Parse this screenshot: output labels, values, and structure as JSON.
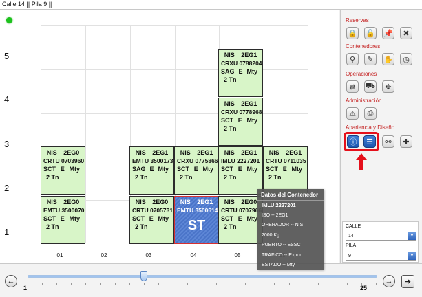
{
  "window": {
    "title": "Calle 14 || Pila 9 ||"
  },
  "grid": {
    "y_labels": [
      "5",
      "4",
      "3",
      "2",
      "1"
    ],
    "x_labels": [
      "01",
      "02",
      "03",
      "04",
      "05",
      "06"
    ]
  },
  "containers": {
    "c1": {
      "line1": [
        "NIS",
        "2EG0"
      ],
      "code": "CRTU 0703960",
      "line3": [
        "SCT",
        "E",
        "Mty"
      ],
      "weight": "2 Tn"
    },
    "c2": {
      "line1": [
        "NIS",
        "2EG0"
      ],
      "code": "EMTU 3500070",
      "line3": [
        "SCT",
        "E",
        "Mty"
      ],
      "weight": "2 Tn"
    },
    "c3": {
      "line1": [
        "NIS",
        "2EG1"
      ],
      "code": "EMTU 3500173",
      "line3": [
        "SAG",
        "E",
        "Mty"
      ],
      "weight": "2 Tn"
    },
    "c4": {
      "line1": [
        "NIS",
        "2EG0"
      ],
      "code": "CRTU 0705731",
      "line3": [
        "SCT",
        "E",
        "Mty"
      ],
      "weight": "2 Tn"
    },
    "c5": {
      "line1": [
        "NIS",
        "2EG1"
      ],
      "code": "CRXU 0775866",
      "line3": [
        "SCT",
        "E",
        "Mty"
      ],
      "weight": "2 Tn"
    },
    "c6": {
      "line1": [
        "NIS",
        "2EG1"
      ],
      "code": "EMTU 3500614",
      "tag": "ST"
    },
    "c7": {
      "line1": [
        "NIS",
        "2EG1"
      ],
      "code": "CRXU 0788204",
      "line3": [
        "SAG",
        "E",
        "Mty"
      ],
      "weight": "2 Tn"
    },
    "c8": {
      "line1": [
        "NIS",
        "2EG1"
      ],
      "code": "CRXU 0778968",
      "line3": [
        "SCT",
        "E",
        "Mty"
      ],
      "weight": "2 Tn"
    },
    "c9": {
      "line1": [
        "NIS",
        "2EG1"
      ],
      "code": "IMLU 2227201",
      "line3": [
        "SCT",
        "E",
        "Mty"
      ],
      "weight": "2 Tn"
    },
    "c10": {
      "line1": [
        "NIS",
        "2EG0"
      ],
      "code": "CRTU 0707966",
      "line3": [
        "SCT",
        "E",
        "Mty"
      ],
      "weight": "2 Tn"
    },
    "c11": {
      "line1": [
        "NIS",
        "2EG1"
      ],
      "code": "CRTU 0711035",
      "line3": [
        "SCT",
        "E",
        "Mty"
      ],
      "weight": "2 Tn"
    }
  },
  "tooltip": {
    "title": "Datos del Contenedor",
    "lines": [
      "IMLU 2227201",
      "ISO -- 2EG1",
      "OPERADOR -- NIS",
      "2000 Kg.",
      "PUERTO -- ESSCT",
      "TRAFICO -- Export",
      "ESTADO -- Mty"
    ]
  },
  "panel": {
    "sections": [
      "Reservas",
      "Contenedores",
      "Operaciones",
      "Administración",
      "Apariencia y Diseño"
    ],
    "calle_label": "CALLE",
    "calle_value": "14",
    "pila_label": "PILA",
    "pila_value": "9"
  },
  "slider": {
    "min": "1",
    "max": "25",
    "value": 9
  },
  "colors": {
    "container_fill": "#d8f5c8",
    "selected_fill": "#4a74c8",
    "section_text": "#c42020",
    "highlight": "#e5101b"
  }
}
